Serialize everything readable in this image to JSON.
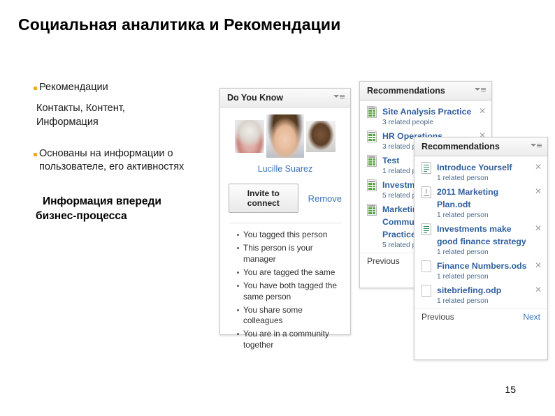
{
  "slide": {
    "title": "Социальная аналитика и Рекомендации",
    "page_number": "15"
  },
  "bullets": {
    "item1_label": "Рекомендации",
    "item1_sub": "Контакты, Контент, Информация",
    "item2_label": "Основаны на информации о пользователе, его активностях",
    "emphasis_line1": "Информация впереди",
    "emphasis_line2": "бизнес-процесса",
    "bullet_color": "#f5a623"
  },
  "do_you_know": {
    "title": "Do You Know",
    "menu_icon": "chevron-down-list-icon",
    "person_name": "Lucille Suarez",
    "invite_label": "Invite to connect",
    "remove_label": "Remove",
    "faces": [
      "face-older-woman",
      "face-woman-dark-hair",
      "face-man"
    ],
    "reasons": [
      "You tagged this person",
      "This person is your manager",
      "You are tagged the same",
      "You have both tagged the same person",
      "You share some colleagues",
      "You are in a community together"
    ]
  },
  "recommendations_back": {
    "title": "Recommendations",
    "menu_icon": "chevron-down-list-icon",
    "close_icon": "close-icon",
    "items": [
      {
        "name": "Site Analysis Practice",
        "meta": "3 related people",
        "icon": "spreadsheet-icon"
      },
      {
        "name": "HR Operations",
        "meta": "3 related people",
        "icon": "spreadsheet-icon"
      },
      {
        "name": "Test",
        "meta": "1 related person",
        "icon": "spreadsheet-icon"
      },
      {
        "name": "Investments",
        "meta": "5 related people",
        "icon": "spreadsheet-icon"
      },
      {
        "name": "Marketing Communication Practice",
        "meta": "5 related people",
        "icon": "spreadsheet-icon"
      }
    ],
    "previous_label": "Previous"
  },
  "recommendations_front": {
    "title": "Recommendations",
    "menu_icon": "chevron-down-list-icon",
    "close_icon": "close-icon",
    "items": [
      {
        "name": "Introduce Yourself",
        "meta": "1 related person",
        "icon": "text-document-icon"
      },
      {
        "name": "2011 Marketing Plan.odt",
        "meta": "1 related person",
        "icon": "odt-document-icon"
      },
      {
        "name": "Investments make good finance strategy",
        "meta": "1 related person",
        "icon": "text-document-icon"
      },
      {
        "name": "Finance Numbers.ods",
        "meta": "1 related person",
        "icon": "blank-page-icon"
      },
      {
        "name": "sitebriefing.odp",
        "meta": "1 related person",
        "icon": "blank-page-icon"
      }
    ],
    "previous_label": "Previous",
    "next_label": "Next",
    "link_color": "#2f5f9e"
  }
}
